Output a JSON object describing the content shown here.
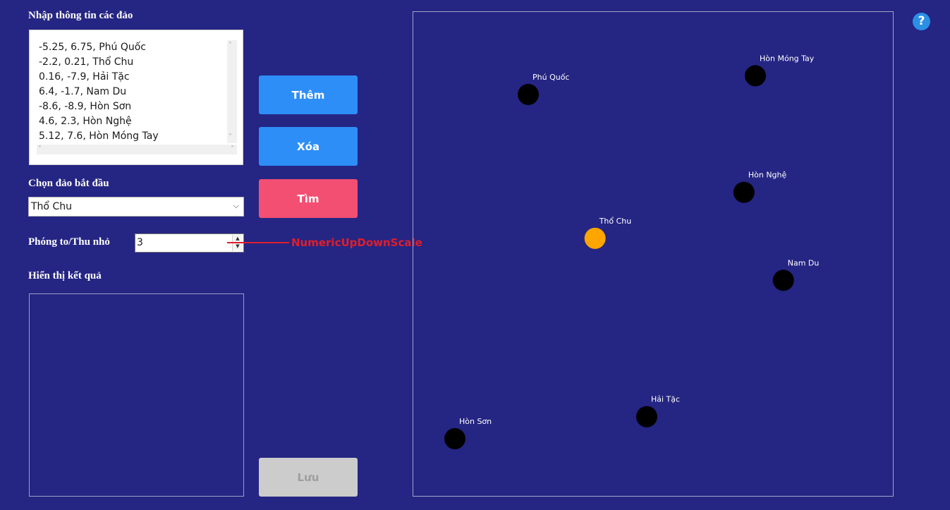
{
  "labels": {
    "input_islands": "Nhập thông tin các đảo",
    "choose_start": "Chọn đảo bắt đầu",
    "zoom": "Phóng to/Thu nhỏ",
    "show_result": "Hiển thị kết quả"
  },
  "islands_text": [
    "-5.25, 6.75, Phú Quốc",
    "-2.2, 0.21, Thổ Chu",
    "0.16, -7.9, Hải Tặc",
    "6.4, -1.7, Nam Du",
    "-8.6, -8.9, Hòn Sơn",
    "4.6, 2.3, Hòn Nghệ",
    "5.12, 7.6, Hòn Móng Tay"
  ],
  "start_island": "Thổ Chu",
  "scale_value": "3",
  "annotation": "NumericUpDownScale",
  "buttons": {
    "add": "Thêm",
    "delete": "Xóa",
    "find": "Tìm",
    "save": "Lưu"
  },
  "help_symbol": "?",
  "map": {
    "x_range": [
      -10.5,
      11.4
    ],
    "y_range": [
      -11.5,
      10.5
    ],
    "default_color": "#000000",
    "start_color": "#ffa500",
    "islands": [
      {
        "name": "Phú Quốc",
        "x": -5.25,
        "y": 6.75,
        "start": false
      },
      {
        "name": "Thổ Chu",
        "x": -2.2,
        "y": 0.21,
        "start": true
      },
      {
        "name": "Hải Tặc",
        "x": 0.16,
        "y": -7.9,
        "start": false
      },
      {
        "name": "Nam Du",
        "x": 6.4,
        "y": -1.7,
        "start": false
      },
      {
        "name": "Hòn Sơn",
        "x": -8.6,
        "y": -8.9,
        "start": false
      },
      {
        "name": "Hòn Nghệ",
        "x": 4.6,
        "y": 2.3,
        "start": false
      },
      {
        "name": "Hòn Móng Tay",
        "x": 5.12,
        "y": 7.6,
        "start": false
      }
    ]
  }
}
